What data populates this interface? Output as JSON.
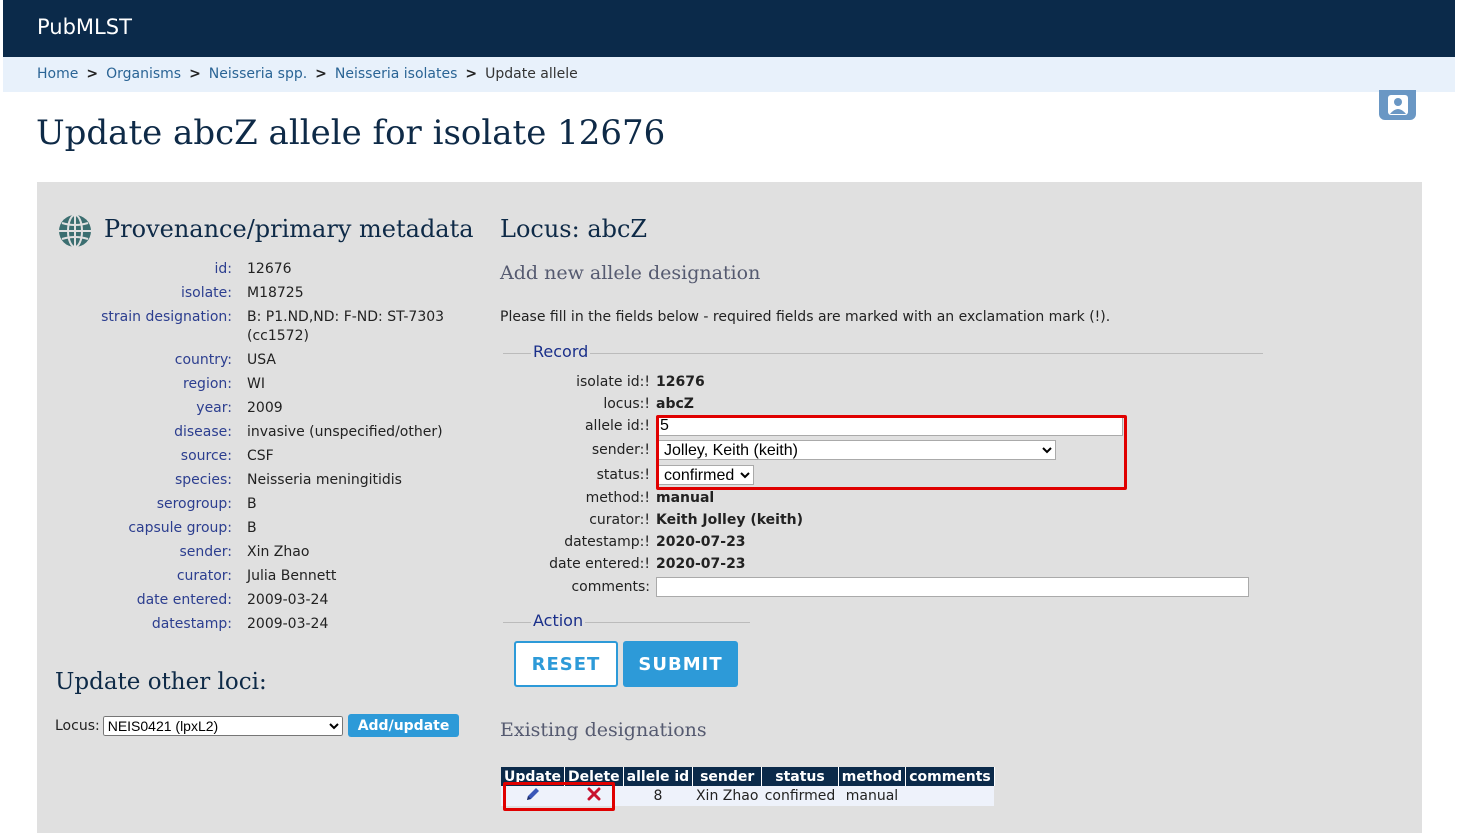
{
  "header": {
    "brand": "PubMLST"
  },
  "breadcrumb": {
    "home": "Home",
    "organisms": "Organisms",
    "genus": "Neisseria spp.",
    "db": "Neisseria isolates",
    "current": "Update allele",
    "sep": ">"
  },
  "page_title": "Update abcZ allele for isolate 12676",
  "provenance": {
    "title": "Provenance/primary metadata",
    "fields": [
      {
        "k": "id:",
        "v": "12676"
      },
      {
        "k": "isolate:",
        "v": "M18725"
      },
      {
        "k": "strain designation:",
        "v": "B: P1.ND,ND: F-ND: ST-7303 (cc1572)"
      },
      {
        "k": "country:",
        "v": "USA"
      },
      {
        "k": "region:",
        "v": "WI"
      },
      {
        "k": "year:",
        "v": "2009"
      },
      {
        "k": "disease:",
        "v": "invasive (unspecified/other)"
      },
      {
        "k": "source:",
        "v": "CSF"
      },
      {
        "k": "species:",
        "v": "Neisseria meningitidis"
      },
      {
        "k": "serogroup:",
        "v": "B"
      },
      {
        "k": "capsule group:",
        "v": "B"
      },
      {
        "k": "sender:",
        "v": "Xin Zhao"
      },
      {
        "k": "curator:",
        "v": "Julia Bennett"
      },
      {
        "k": "date entered:",
        "v": "2009-03-24"
      },
      {
        "k": "datestamp:",
        "v": "2009-03-24"
      }
    ]
  },
  "update_other": {
    "title": "Update other loci:",
    "locus_label": "Locus:",
    "locus_selected": "NEIS0421 (lpxL2)",
    "button": "Add/update"
  },
  "locus": {
    "title": "Locus: abcZ",
    "subtitle": "Add new allele designation",
    "instructions": "Please fill in the fields below - required fields are marked with an exclamation mark (!)."
  },
  "record": {
    "legend": "Record",
    "isolate_id_label": "isolate id:!",
    "isolate_id": "12676",
    "locus_label": "locus:!",
    "locus": "abcZ",
    "allele_id_label": "allele id:!",
    "allele_id": "5",
    "sender_label": "sender:!",
    "sender": "Jolley, Keith (keith)",
    "status_label": "status:!",
    "status": "confirmed",
    "method_label": "method:!",
    "method": "manual",
    "curator_label": "curator:!",
    "curator": "Keith Jolley (keith)",
    "datestamp_label": "datestamp:!",
    "datestamp": "2020-07-23",
    "date_entered_label": "date entered:!",
    "date_entered": "2020-07-23",
    "comments_label": "comments:",
    "comments": ""
  },
  "action": {
    "legend": "Action",
    "reset": "RESET",
    "submit": "SUBMIT"
  },
  "existing": {
    "title": "Existing designations",
    "headers": [
      "Update",
      "Delete",
      "allele id",
      "sender",
      "status",
      "method",
      "comments"
    ],
    "row": {
      "allele_id": "8",
      "sender": "Xin Zhao",
      "status": "confirmed",
      "method": "manual",
      "comments": ""
    }
  },
  "colors": {
    "navy": "#0b2a4a",
    "accent": "#2d9ad8",
    "highlight": "#e00000",
    "panel": "#e0e0e0"
  }
}
